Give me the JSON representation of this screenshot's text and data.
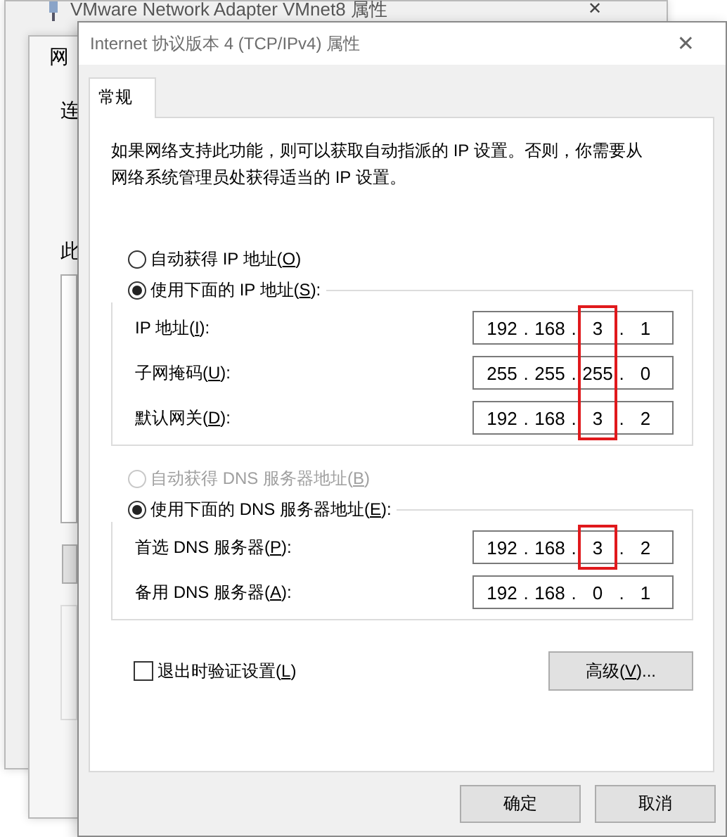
{
  "back_window": {
    "title": "VMware Network Adapter VMnet8 属性",
    "close": "✕",
    "fragments": [
      "网",
      "连",
      "此"
    ]
  },
  "window": {
    "title": "Internet 协议版本 4 (TCP/IPv4) 属性",
    "close": "✕"
  },
  "tabs": [
    {
      "label": "常规",
      "selected": true
    }
  ],
  "intro": "如果网络支持此功能，则可以获取自动指派的 IP 设置。否则，你需要从网络系统管理员处获得适当的 IP 设置。",
  "ip_mode": [
    {
      "label": "自动获得 IP 地址(O)",
      "selected": false,
      "disabled": false
    },
    {
      "label": "使用下面的 IP 地址(S):",
      "selected": true,
      "disabled": false
    }
  ],
  "ip_fields": [
    {
      "label": "IP 地址(I):",
      "separator": ".",
      "octets": [
        {
          "text": "192",
          "marked": false
        },
        {
          "text": "168",
          "marked": false
        },
        {
          "text": "3",
          "marked": true
        },
        {
          "text": "1",
          "marked": false
        }
      ]
    },
    {
      "label": "子网掩码(U):",
      "separator": ".",
      "octets": [
        {
          "text": "255",
          "marked": false
        },
        {
          "text": "255",
          "marked": false
        },
        {
          "text": "255",
          "marked": true
        },
        {
          "text": "0",
          "marked": false
        }
      ]
    },
    {
      "label": "默认网关(D):",
      "separator": ".",
      "octets": [
        {
          "text": "192",
          "marked": false
        },
        {
          "text": "168",
          "marked": false
        },
        {
          "text": "3",
          "marked": true
        },
        {
          "text": "2",
          "marked": false
        }
      ]
    }
  ],
  "dns_mode": [
    {
      "label": "自动获得 DNS 服务器地址(B)",
      "selected": false,
      "disabled": true
    },
    {
      "label": "使用下面的 DNS 服务器地址(E):",
      "selected": true,
      "disabled": false
    }
  ],
  "dns_fields": [
    {
      "label": "首选 DNS 服务器(P):",
      "separator": ".",
      "octets": [
        {
          "text": "192",
          "marked": false
        },
        {
          "text": "168",
          "marked": false
        },
        {
          "text": "3",
          "marked": true
        },
        {
          "text": "2",
          "marked": false
        }
      ]
    },
    {
      "label": "备用 DNS 服务器(A):",
      "separator": ".",
      "octets": [
        {
          "text": "192",
          "marked": false
        },
        {
          "text": "168",
          "marked": false
        },
        {
          "text": "0",
          "marked": false
        },
        {
          "text": "1",
          "marked": false
        }
      ]
    }
  ],
  "validate": {
    "label": "退出时验证设置(L)",
    "checked": false
  },
  "advanced_button": "高级(V)...",
  "buttons": [
    "确定",
    "取消"
  ]
}
